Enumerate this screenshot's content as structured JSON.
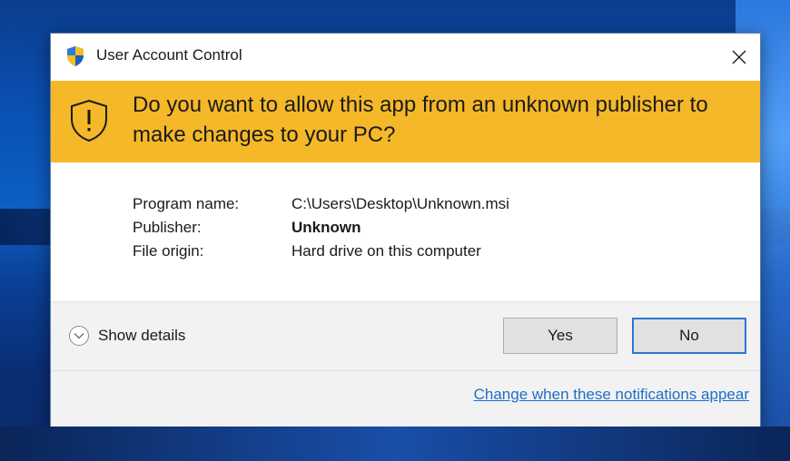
{
  "window": {
    "title": "User Account Control",
    "close_icon": "close-icon"
  },
  "banner": {
    "question": "Do you want to allow this app from an unknown publisher to make changes to your PC?",
    "icon": "warning-shield-icon",
    "color": "#f5b829"
  },
  "info": {
    "rows": [
      {
        "label": "Program name:",
        "value": "C:\\Users\\Desktop\\Unknown.msi"
      },
      {
        "label": "Publisher:",
        "value": "Unknown"
      },
      {
        "label": "File origin:",
        "value": "Hard drive on this computer"
      }
    ]
  },
  "footer": {
    "show_details": "Show details",
    "yes_label": "Yes",
    "no_label": "No",
    "notifications_link": "Change when these notifications appear"
  }
}
